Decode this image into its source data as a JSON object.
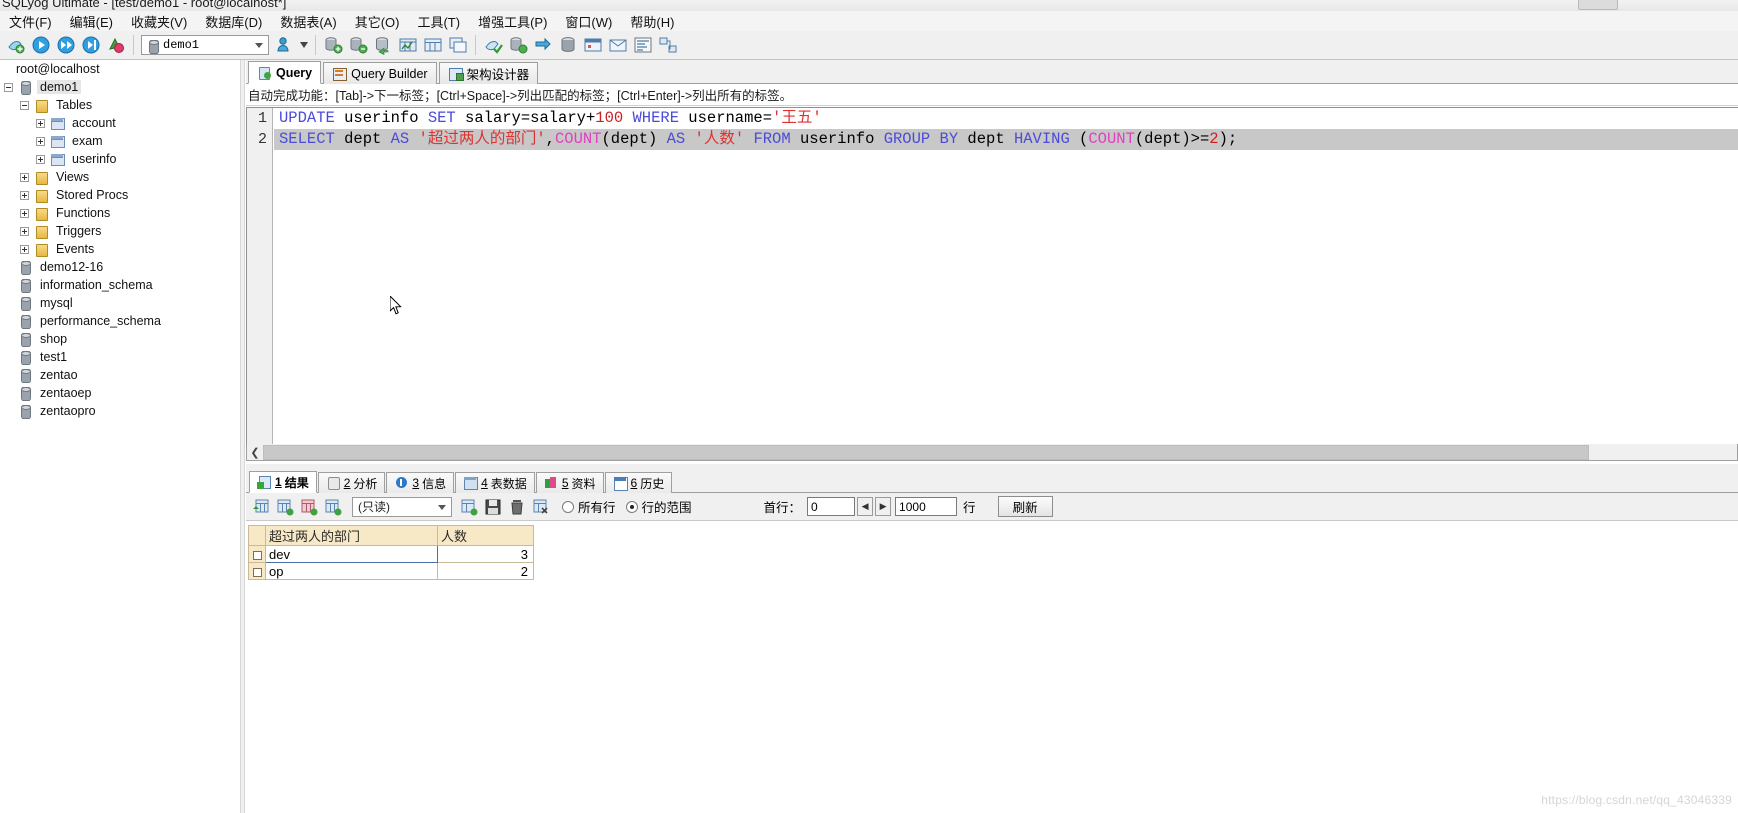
{
  "window": {
    "title": "SQLyog Ultimate - [test/demo1 - root@localhost*]"
  },
  "menu": {
    "items": [
      {
        "label": "文件(F)",
        "name": "menu-file"
      },
      {
        "label": "编辑(E)",
        "name": "menu-edit"
      },
      {
        "label": "收藏夹(V)",
        "name": "menu-favorites"
      },
      {
        "label": "数据库(D)",
        "name": "menu-database"
      },
      {
        "label": "数据表(A)",
        "name": "menu-table"
      },
      {
        "label": "其它(O)",
        "name": "menu-other"
      },
      {
        "label": "工具(T)",
        "name": "menu-tools"
      },
      {
        "label": "增强工具(P)",
        "name": "menu-powertools"
      },
      {
        "label": "窗口(W)",
        "name": "menu-window"
      },
      {
        "label": "帮助(H)",
        "name": "menu-help"
      }
    ]
  },
  "toolbar": {
    "database_combo_value": "demo1",
    "buttons": [
      {
        "name": "new-connection-button",
        "icon": "connection-icon"
      },
      {
        "name": "execute-query-button",
        "icon": "play-icon"
      },
      {
        "name": "execute-all-queries-button",
        "icon": "fast-forward-icon"
      },
      {
        "name": "execute-current-query-button",
        "icon": "play-cursor-icon"
      },
      {
        "name": "stop-button",
        "icon": "stop-refresh-icon"
      }
    ]
  },
  "sidebar": {
    "root": "root@localhost",
    "nodes": [
      {
        "label": "demo1",
        "icon": "db-icon",
        "indent": 0,
        "toggle": "minus",
        "selected": true,
        "name": "tree-node-demo1"
      },
      {
        "label": "Tables",
        "icon": "folder-icon",
        "indent": 1,
        "toggle": "minus",
        "name": "tree-node-tables"
      },
      {
        "label": "account",
        "icon": "table-icon",
        "indent": 2,
        "toggle": "plus",
        "name": "tree-node-account"
      },
      {
        "label": "exam",
        "icon": "table-icon",
        "indent": 2,
        "toggle": "plus",
        "name": "tree-node-exam"
      },
      {
        "label": "userinfo",
        "icon": "table-icon",
        "indent": 2,
        "toggle": "plus",
        "name": "tree-node-userinfo"
      },
      {
        "label": "Views",
        "icon": "folder-icon",
        "indent": 1,
        "toggle": "plus",
        "name": "tree-node-views"
      },
      {
        "label": "Stored Procs",
        "icon": "folder-icon",
        "indent": 1,
        "toggle": "plus",
        "name": "tree-node-stored-procs"
      },
      {
        "label": "Functions",
        "icon": "folder-icon",
        "indent": 1,
        "toggle": "plus",
        "name": "tree-node-functions"
      },
      {
        "label": "Triggers",
        "icon": "folder-icon",
        "indent": 1,
        "toggle": "plus",
        "name": "tree-node-triggers"
      },
      {
        "label": "Events",
        "icon": "folder-icon",
        "indent": 1,
        "toggle": "plus",
        "name": "tree-node-events"
      },
      {
        "label": "demo12-16",
        "icon": "db-icon",
        "indent": 0,
        "toggle": "none",
        "name": "tree-node-demo12-16"
      },
      {
        "label": "information_schema",
        "icon": "db-icon",
        "indent": 0,
        "toggle": "none",
        "name": "tree-node-information-schema"
      },
      {
        "label": "mysql",
        "icon": "db-icon",
        "indent": 0,
        "toggle": "none",
        "name": "tree-node-mysql"
      },
      {
        "label": "performance_schema",
        "icon": "db-icon",
        "indent": 0,
        "toggle": "none",
        "name": "tree-node-performance-schema"
      },
      {
        "label": "shop",
        "icon": "db-icon",
        "indent": 0,
        "toggle": "none",
        "name": "tree-node-shop"
      },
      {
        "label": "test1",
        "icon": "db-icon",
        "indent": 0,
        "toggle": "none",
        "name": "tree-node-test1"
      },
      {
        "label": "zentao",
        "icon": "db-icon",
        "indent": 0,
        "toggle": "none",
        "name": "tree-node-zentao"
      },
      {
        "label": "zentaoep",
        "icon": "db-icon",
        "indent": 0,
        "toggle": "none",
        "name": "tree-node-zentaoep"
      },
      {
        "label": "zentaopro",
        "icon": "db-icon",
        "indent": 0,
        "toggle": "none",
        "name": "tree-node-zentaopro"
      }
    ]
  },
  "editor": {
    "tabs": [
      {
        "label": "Query",
        "icon": "query-icon",
        "active": true,
        "name": "tab-query"
      },
      {
        "label": "Query Builder",
        "icon": "query-builder-icon",
        "active": false,
        "name": "tab-query-builder"
      },
      {
        "label": "架构设计器",
        "icon": "schema-designer-icon",
        "active": false,
        "name": "tab-schema-designer"
      }
    ],
    "hint": "自动完成功能：[Tab]->下一标签；[Ctrl+Space]->列出匹配的标签；[Ctrl+Enter]->列出所有的标签。",
    "line_numbers": [
      "1",
      "2"
    ],
    "sql_line1": "UPDATE userinfo SET salary=salary+100 WHERE username='王五'",
    "sql_line2": "SELECT dept AS '超过两人的部门',COUNT(dept) AS '人数' FROM userinfo GROUP BY dept HAVING (COUNT(dept)>=2);",
    "line1_tokens": [
      {
        "t": "UPDATE",
        "c": "kw"
      },
      {
        "t": " userinfo ",
        "c": "plain"
      },
      {
        "t": "SET",
        "c": "kw"
      },
      {
        "t": " salary=salary+",
        "c": "plain"
      },
      {
        "t": "100",
        "c": "num"
      },
      {
        "t": " ",
        "c": "plain"
      },
      {
        "t": "WHERE",
        "c": "kw"
      },
      {
        "t": " username=",
        "c": "plain"
      },
      {
        "t": "'王五'",
        "c": "str"
      }
    ],
    "line2_tokens": [
      {
        "t": "SELECT",
        "c": "kw"
      },
      {
        "t": " dept ",
        "c": "plain"
      },
      {
        "t": "AS",
        "c": "kw"
      },
      {
        "t": " ",
        "c": "plain"
      },
      {
        "t": "'超过两人的部门'",
        "c": "str"
      },
      {
        "t": ",",
        "c": "plain"
      },
      {
        "t": "COUNT",
        "c": "fn"
      },
      {
        "t": "(dept) ",
        "c": "plain"
      },
      {
        "t": "AS",
        "c": "kw"
      },
      {
        "t": " ",
        "c": "plain"
      },
      {
        "t": "'人数'",
        "c": "str"
      },
      {
        "t": " ",
        "c": "plain"
      },
      {
        "t": "FROM",
        "c": "kw"
      },
      {
        "t": " userinfo ",
        "c": "plain"
      },
      {
        "t": "GROUP",
        "c": "kw"
      },
      {
        "t": " ",
        "c": "plain"
      },
      {
        "t": "BY",
        "c": "kw"
      },
      {
        "t": " dept ",
        "c": "plain"
      },
      {
        "t": "HAVING",
        "c": "kw"
      },
      {
        "t": " (",
        "c": "plain"
      },
      {
        "t": "COUNT",
        "c": "fn"
      },
      {
        "t": "(dept)>=",
        "c": "plain"
      },
      {
        "t": "2",
        "c": "num"
      },
      {
        "t": ");",
        "c": "plain"
      }
    ]
  },
  "results": {
    "tabs": [
      {
        "num": "1",
        "label": "结果",
        "icon": "result-icon",
        "active": true,
        "name": "result-tab-result"
      },
      {
        "num": "2",
        "label": "分析",
        "icon": "profile-icon",
        "active": false,
        "name": "result-tab-profile"
      },
      {
        "num": "3",
        "label": "信息",
        "icon": "info-icon",
        "active": false,
        "name": "result-tab-messages"
      },
      {
        "num": "4",
        "label": "表数据",
        "icon": "table-data-icon",
        "active": false,
        "name": "result-tab-table-data"
      },
      {
        "num": "5",
        "label": "资料",
        "icon": "object-info-icon",
        "active": false,
        "name": "result-tab-object-info"
      },
      {
        "num": "6",
        "label": "历史",
        "icon": "history-icon",
        "active": false,
        "name": "result-tab-history"
      }
    ],
    "toolbar": {
      "mode_value": "(只读)",
      "radio_all_rows": "所有行",
      "radio_row_range": "行的范围",
      "radio_selected": "row_range",
      "first_row_label": "首行：",
      "first_row_value": "0",
      "limit_value": "1000",
      "rows_unit": "行",
      "refresh_label": "刷新"
    },
    "grid": {
      "columns": [
        "超过两人的部门",
        "人数"
      ],
      "rows": [
        {
          "dept": "dev",
          "count": "3",
          "selected": true
        },
        {
          "dept": "op",
          "count": "2",
          "selected": false
        }
      ]
    }
  },
  "watermark": "https://blog.csdn.net/qq_43046339"
}
